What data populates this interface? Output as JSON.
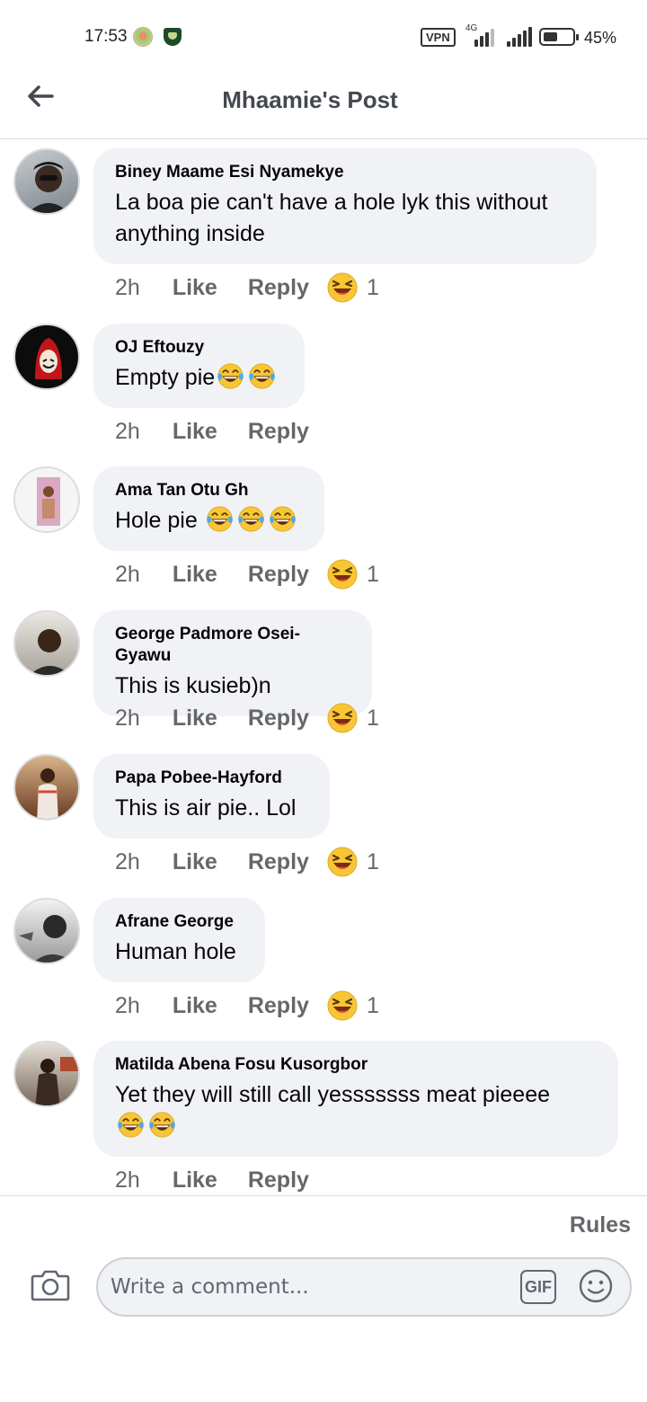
{
  "status_bar": {
    "time": "17:53",
    "vpn": "VPN",
    "network": "4G",
    "battery": "45%"
  },
  "header": {
    "title": "Mhaamie's Post",
    "back_icon": "arrow-left-icon"
  },
  "comments": [
    {
      "name": "Biney Maame Esi Nyamekye",
      "text": "La boa pie can't have a hole lyk this without anything inside",
      "time": "2h",
      "like": "Like",
      "reply": "Reply",
      "reactions": "1",
      "reaction_icon": "laughing-emoji-icon"
    },
    {
      "name": "OJ Eftouzy",
      "text": "Empty pie",
      "time": "2h",
      "like": "Like",
      "reply": "Reply",
      "text_emojis": 2
    },
    {
      "name": "Ama Tan Otu Gh",
      "text": "Hole pie ",
      "time": "2h",
      "like": "Like",
      "reply": "Reply",
      "reactions": "1",
      "text_emojis": 3
    },
    {
      "name": "George Padmore Osei-Gyawu",
      "text": "This is kusieb)n",
      "time": "2h",
      "like": "Like",
      "reply": "Reply",
      "reactions": "1"
    },
    {
      "name": "Papa Pobee-Hayford",
      "text": "This is air pie.. Lol",
      "time": "2h",
      "like": "Like",
      "reply": "Reply",
      "reactions": "1"
    },
    {
      "name": "Afrane George",
      "text": "Human hole",
      "time": "2h",
      "like": "Like",
      "reply": "Reply",
      "reactions": "1"
    },
    {
      "name": "Matilda Abena Fosu Kusorgbor",
      "text": "Yet they will still call yesssssss meat pieeee",
      "time": "2h",
      "like": "Like",
      "reply": "Reply",
      "text_emojis": 2
    }
  ],
  "composer": {
    "rules": "Rules",
    "placeholder": "Write a comment...",
    "gif": "GIF"
  },
  "colors": {
    "bubble": "#f0f2f5",
    "meta_text": "#65676b",
    "title": "#444950"
  }
}
